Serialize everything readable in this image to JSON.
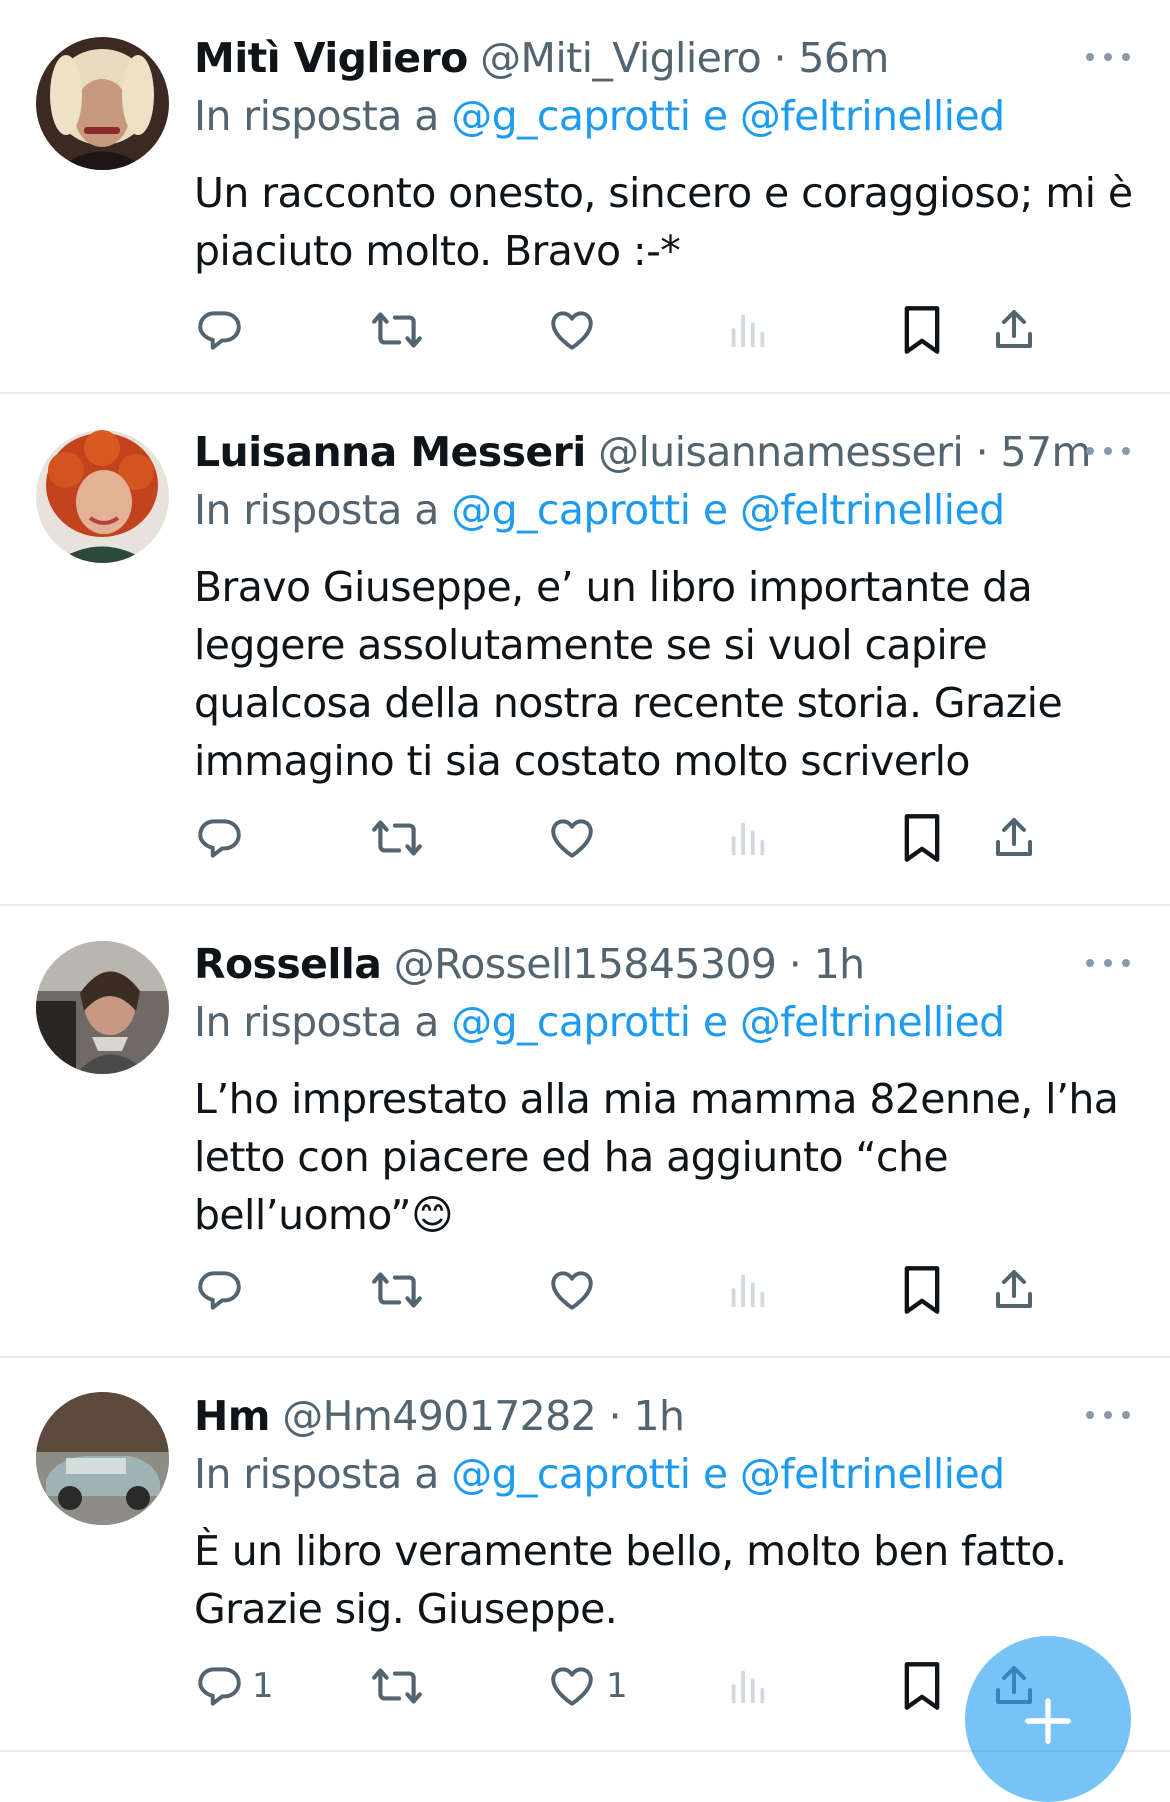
{
  "tweets": [
    {
      "name": "Mitì Vigliero",
      "handle": "@Miti_Vigliero",
      "sep": "·",
      "time": "56m",
      "reply_prefix": "In risposta a ",
      "mention1": "@g_caprotti",
      "conj": " e ",
      "mention2": "@feltrinellied",
      "text": "Un racconto onesto, sincero e coraggioso; mi è piaciuto molto. Bravo :-*",
      "reply_count": "",
      "retweet_count": "",
      "like_count": ""
    },
    {
      "name": "Luisanna Messeri",
      "handle": "@luisannamesseri",
      "sep": "·",
      "time": "57m",
      "reply_prefix": "In risposta a ",
      "mention1": "@g_caprotti",
      "conj": " e ",
      "mention2": "@feltrinellied",
      "text": "Bravo Giuseppe, e’ un libro importante da leggere assolutamente se si vuol capire qualcosa della nostra recente storia. Grazie immagino ti sia costato molto scriverlo",
      "reply_count": "",
      "retweet_count": "",
      "like_count": ""
    },
    {
      "name": "Rossella",
      "handle": "@Rossell15845309",
      "sep": "·",
      "time": "1h",
      "reply_prefix": "In risposta a ",
      "mention1": "@g_caprotti",
      "conj": " e ",
      "mention2": "@feltrinellied",
      "text": "L’ho imprestato alla mia mamma 82enne, l’ha letto con piacere ed ha aggiunto “che bell’uomo”😊",
      "reply_count": "",
      "retweet_count": "",
      "like_count": ""
    },
    {
      "name": "Hm",
      "handle": "@Hm49017282",
      "sep": "·",
      "time": "1h",
      "reply_prefix": "In risposta a ",
      "mention1": "@g_caprotti",
      "conj": " e ",
      "mention2": "@feltrinellied",
      "text": "È un libro veramente bello, molto ben fatto. Grazie sig. Giuseppe.",
      "reply_count": "1",
      "retweet_count": "",
      "like_count": "1"
    }
  ],
  "icons": {
    "reply": "reply-icon",
    "retweet": "retweet-icon",
    "like": "heart-icon",
    "views": "views-icon",
    "bookmark": "bookmark-icon",
    "share": "share-icon",
    "more": "more-icon",
    "compose": "plus-icon"
  },
  "colors": {
    "accent": "#1d9bf0",
    "muted": "#536471",
    "text": "#0f1419",
    "divider": "#e7e9ea"
  }
}
